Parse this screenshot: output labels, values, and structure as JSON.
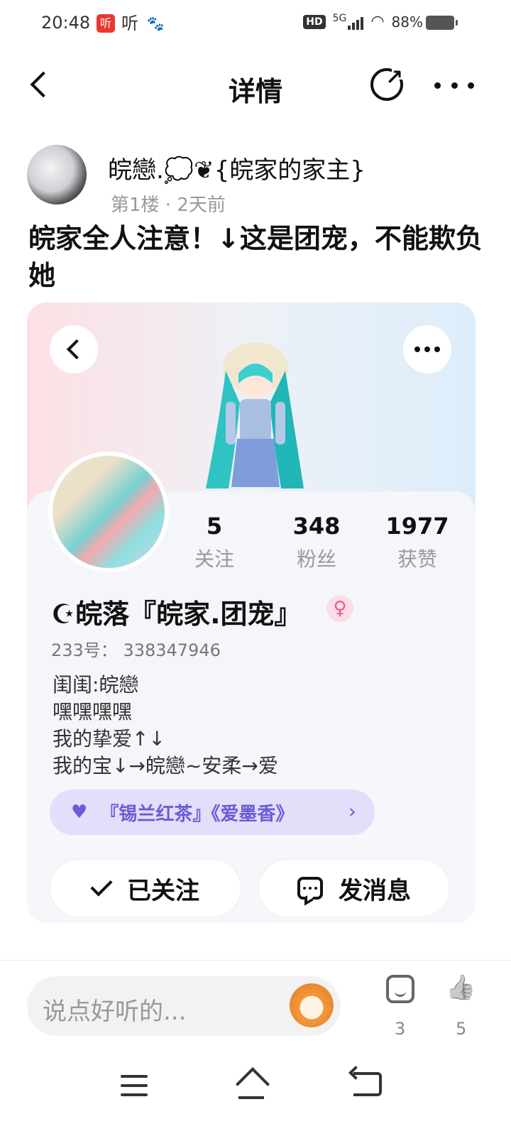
{
  "status_bar": {
    "time": "20:48",
    "app_icon_1": "听",
    "app_icon_2": "听",
    "network": "5G",
    "hd": "HD",
    "battery": "88%"
  },
  "header": {
    "title": "详情"
  },
  "post": {
    "author": "皖戀.💭❦{皖家的家主}",
    "meta": "第1楼 · 2天前",
    "text": "皖家全人注意！↓这是团宠，不能欺负她"
  },
  "profile_card": {
    "stats": [
      {
        "value": "5",
        "label": "关注"
      },
      {
        "value": "348",
        "label": "粉丝"
      },
      {
        "value": "1977",
        "label": "获赞"
      }
    ],
    "name": "☪皖落『皖家.团宠』",
    "gender_symbol": "♀",
    "user_id": "233号： 338347946",
    "bio": [
      "闺闺:皖戀",
      "嘿嘿嘿嘿",
      "我的挚爱↑↓",
      "我的宝↓→皖戀~安柔→爱"
    ],
    "tag": "『锡兰红茶』《爱墨香》",
    "tag_chevron": "›",
    "followed_label": "已关注",
    "message_label": "发消息"
  },
  "comment_bar": {
    "placeholder": "说点好听的...",
    "emoji_count": "3",
    "like_count": "5"
  }
}
